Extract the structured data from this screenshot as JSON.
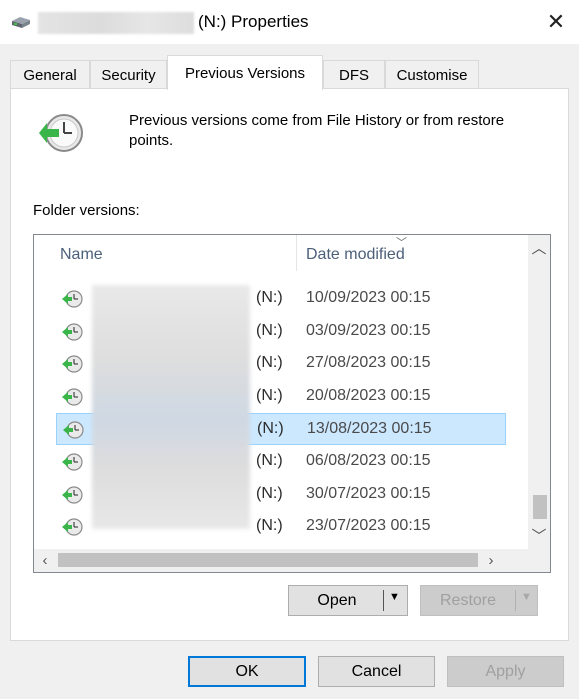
{
  "window": {
    "title": "(N:) Properties",
    "close_label": "✕"
  },
  "tabs": [
    {
      "label": "General"
    },
    {
      "label": "Security"
    },
    {
      "label": "Previous Versions"
    },
    {
      "label": "DFS"
    },
    {
      "label": "Customise"
    }
  ],
  "active_tab": "Previous Versions",
  "info": {
    "text": "Previous versions come from File History or from restore points."
  },
  "folder_versions_label": "Folder versions:",
  "list": {
    "columns": [
      "Name",
      "Date modified"
    ],
    "rows": [
      {
        "drive": "(N:)",
        "date": "10/09/2023 00:15",
        "selected": false
      },
      {
        "drive": "(N:)",
        "date": "03/09/2023 00:15",
        "selected": false
      },
      {
        "drive": "(N:)",
        "date": "27/08/2023 00:15",
        "selected": false
      },
      {
        "drive": "(N:)",
        "date": "20/08/2023 00:15",
        "selected": false
      },
      {
        "drive": "(N:)",
        "date": "13/08/2023 00:15",
        "selected": true
      },
      {
        "drive": "(N:)",
        "date": "06/08/2023 00:15",
        "selected": false
      },
      {
        "drive": "(N:)",
        "date": "30/07/2023 00:15",
        "selected": false
      },
      {
        "drive": "(N:)",
        "date": "23/07/2023 00:15",
        "selected": false
      }
    ]
  },
  "buttons": {
    "open": "Open",
    "restore": "Restore",
    "ok": "OK",
    "cancel": "Cancel",
    "apply": "Apply"
  },
  "colors": {
    "selection": "#cce8ff",
    "selection_border": "#99d1ff",
    "header_text": "#4c607a",
    "default_button_border": "#0078d7"
  }
}
